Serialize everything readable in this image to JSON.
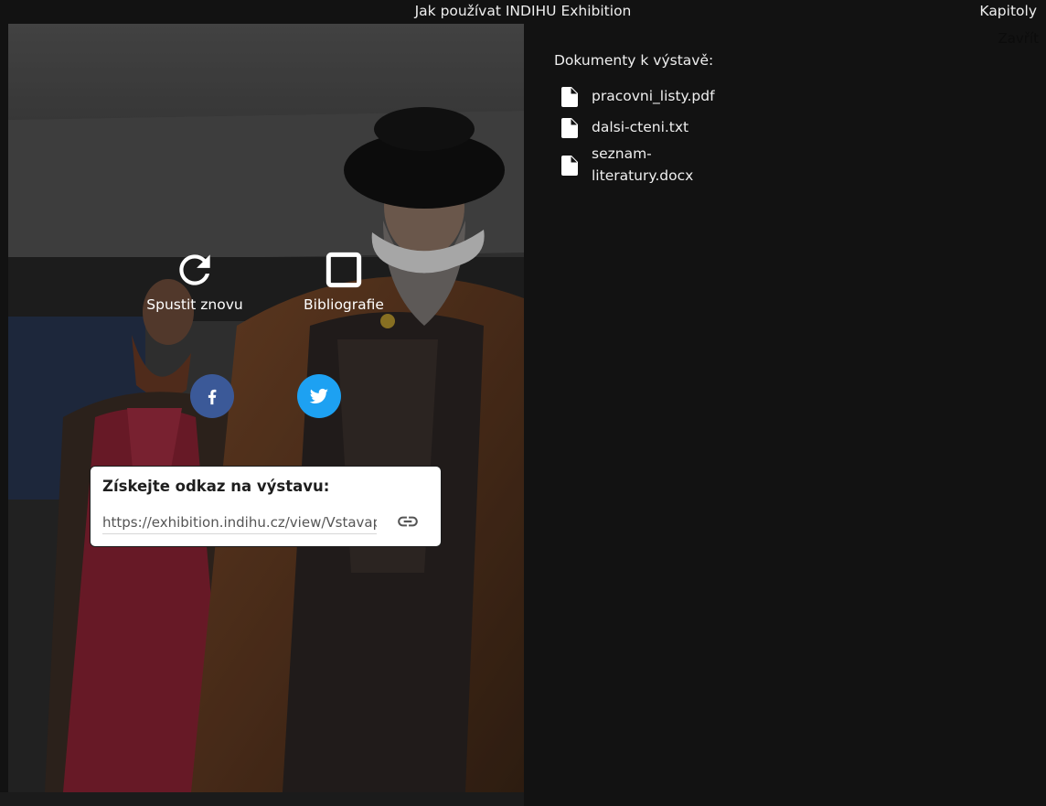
{
  "header": {
    "title": "Jak používat INDIHU Exhibition",
    "chapters_label": "Kapitoly",
    "close_label": "Zavřít"
  },
  "actions": {
    "restart_label": "Spustit znovu",
    "bibliography_label": "Bibliografie"
  },
  "social": {
    "facebook_icon": "facebook-icon",
    "twitter_icon": "twitter-icon",
    "facebook_color": "#3b5998",
    "twitter_color": "#1da1f2"
  },
  "share": {
    "title": "Získejte odkaz na výstavu:",
    "url": "https://exhibition.indihu.cz/view/Vstavapracovnilisty"
  },
  "documents": {
    "heading": "Dokumenty k výstavě:",
    "items": [
      {
        "name": "pracovni_listy.pdf"
      },
      {
        "name": "dalsi-cteni.txt"
      },
      {
        "name": "seznam-literatury.docx"
      }
    ]
  }
}
